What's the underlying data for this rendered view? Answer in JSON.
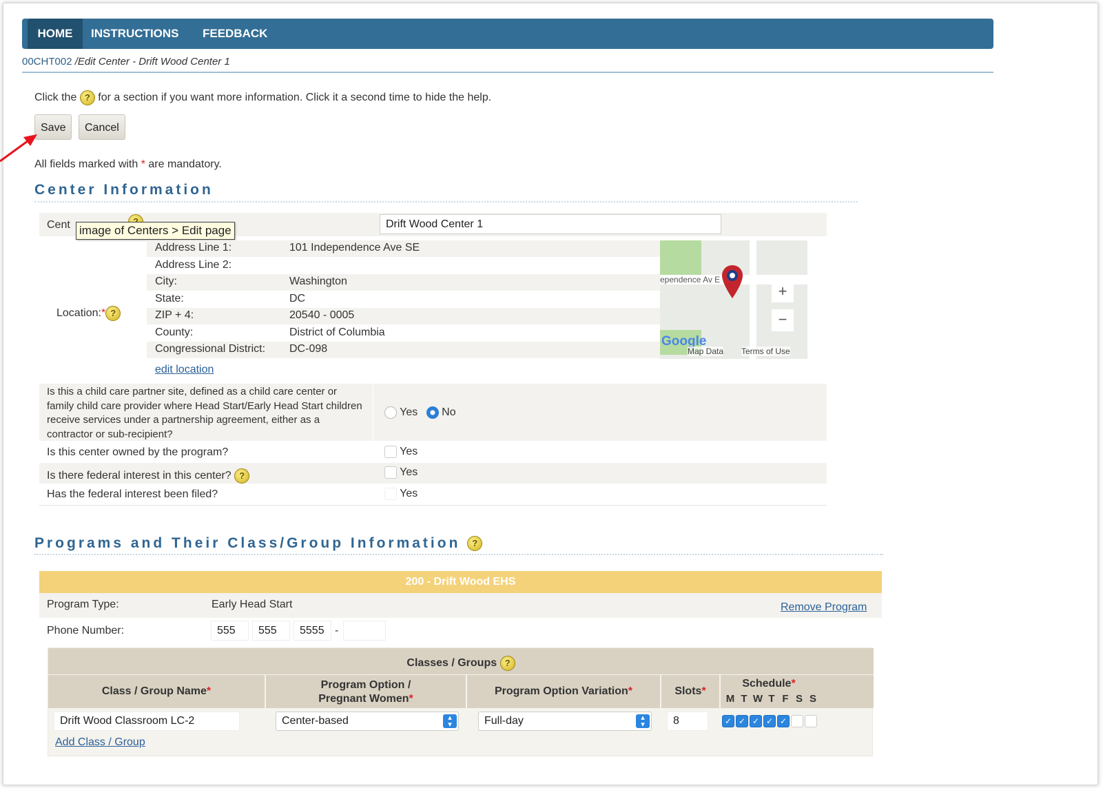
{
  "nav": {
    "home": "HOME",
    "instructions": "INSTRUCTIONS",
    "feedback": "FEEDBACK"
  },
  "breadcrumb": {
    "code": "00CHT002",
    "rest": " /Edit Center - Drift Wood Center 1"
  },
  "help": {
    "before": "Click the ",
    "after": " for a section if you want more information. Click it a second time to hide the help."
  },
  "buttons": {
    "save": "Save",
    "cancel": "Cancel"
  },
  "mandatory": {
    "before": "All fields marked with ",
    "star": "*",
    "after": " are mandatory."
  },
  "center_info": {
    "title": "Center Information",
    "name_label": "Cent",
    "tooltip": "image of Centers > Edit page",
    "name_value": "Drift Wood Center 1",
    "location_label": "Location:",
    "address": [
      {
        "label": "Address Line 1:",
        "value": "101 Independence Ave SE"
      },
      {
        "label": "Address Line 2:",
        "value": ""
      },
      {
        "label": "City:",
        "value": "Washington"
      },
      {
        "label": "State:",
        "value": "DC"
      },
      {
        "label": "ZIP + 4:",
        "value": "20540 - 0005"
      },
      {
        "label": "County:",
        "value": "District of Columbia"
      },
      {
        "label": "Congressional District:",
        "value": "DC-098"
      }
    ],
    "edit_location": "edit location",
    "map": {
      "street": "ependence Av E",
      "google": "Google",
      "map_data": "Map Data",
      "terms": "Terms of Use",
      "plus": "+",
      "minus": "−"
    },
    "q1": "Is this a child care partner site, defined as a child care center or family child care provider where Head Start/Early Head Start children receive services under a partnership agreement, either as a contractor or sub-recipient?",
    "q1_yes": "Yes",
    "q1_no": "No",
    "q2": "Is this center owned by the program?",
    "q3": "Is there federal interest in this center?",
    "q4": "Has the federal interest been filed?",
    "yes": "Yes"
  },
  "programs": {
    "title": "Programs and Their Class/Group Information",
    "program_header": "200 - Drift Wood EHS",
    "program_type_label": "Program Type:",
    "program_type_value": "Early Head Start",
    "remove_program": "Remove Program",
    "phone_label": "Phone Number:",
    "phone": {
      "area": "555",
      "prefix": "555",
      "line": "5555",
      "dash": "-",
      "ext": ""
    },
    "classes_title": "Classes / Groups",
    "columns": {
      "name": "Class / Group Name",
      "option": "Program Option /",
      "option2": "Pregnant Women",
      "variation": "Program Option Variation",
      "slots": "Slots",
      "schedule": "Schedule"
    },
    "days": [
      "M",
      "T",
      "W",
      "T",
      "F",
      "S",
      "S"
    ],
    "row": {
      "name": "Drift Wood Classroom LC-2",
      "option": "Center-based",
      "variation": "Full-day",
      "slots": "8",
      "schedule_checked": [
        true,
        true,
        true,
        true,
        true,
        false,
        false
      ]
    },
    "add_class": "Add Class / Group"
  },
  "colors": {
    "nav": "#336e96",
    "nav_active": "#22506f",
    "accent_title": "#2f6592",
    "program_header": "#f4d27a",
    "table_header": "#d9d2c3"
  }
}
